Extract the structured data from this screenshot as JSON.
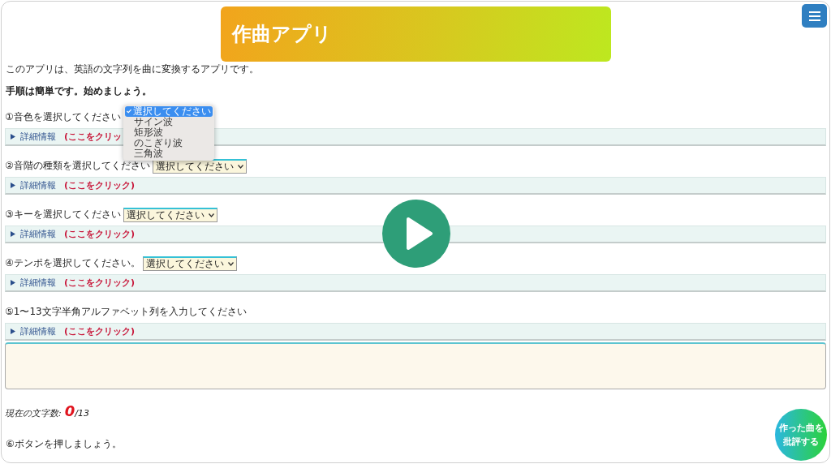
{
  "header": {
    "title": "作曲アプリ"
  },
  "intro": [
    {
      "text": "このアプリは、英語の文字列を曲に変換するアプリです。",
      "bold": false
    },
    {
      "text": "手順は簡単です。始めましょう。",
      "bold": true
    }
  ],
  "steps": [
    {
      "label": "①音色を選択してください",
      "kind": "select",
      "options": [
        {
          "label": "選択してください",
          "selected": true
        },
        {
          "label": "サイン波",
          "selected": false
        },
        {
          "label": "矩形波",
          "selected": false
        },
        {
          "label": "のこぎり波",
          "selected": false
        },
        {
          "label": "三角波",
          "selected": false
        }
      ],
      "details_label": "詳細情報",
      "details_hint": "(ここをクリッ"
    },
    {
      "label": "②音階の種類を選択してください",
      "kind": "select",
      "value": "選択してください",
      "details_label": "詳細情報",
      "details_hint": "(ここをクリック)"
    },
    {
      "label": "③キーを選択してください",
      "kind": "select",
      "value": "選択してください",
      "details_label": "詳細情報",
      "details_hint": "(ここをクリック)"
    },
    {
      "label": "④テンポを選択してください。",
      "kind": "select",
      "value": "選択してください",
      "details_label": "詳細情報",
      "details_hint": "(ここをクリック)"
    },
    {
      "label": "⑤1〜13文字半角アルファベット列を入力してください",
      "kind": "textarea",
      "details_label": "詳細情報",
      "details_hint": "(ここをクリック)"
    }
  ],
  "counter": {
    "label": "現在の文字数:",
    "count": "0",
    "max": "/13"
  },
  "final_step": {
    "label": "⑥ボタンを押しましょう。"
  },
  "review_button": {
    "label": "作った曲を批評する"
  }
}
